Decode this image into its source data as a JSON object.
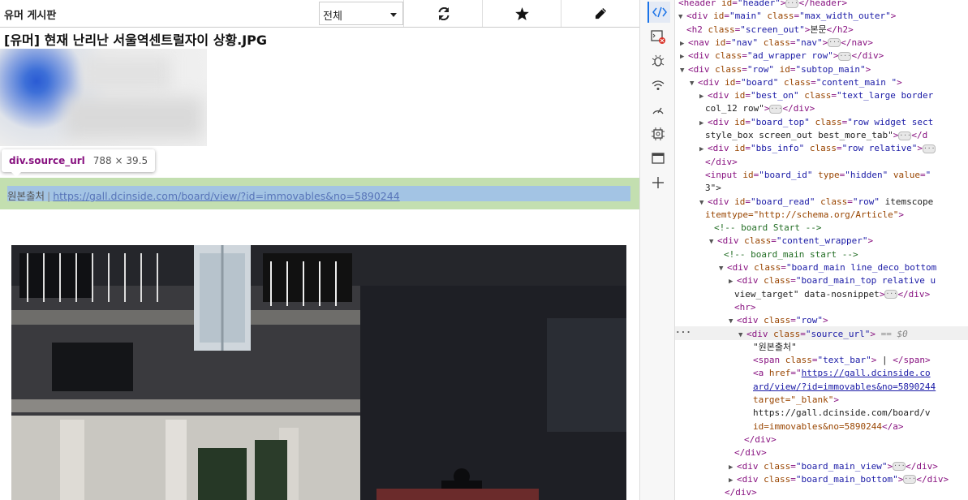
{
  "topbar": {
    "board_title": "유머 게시판",
    "select_value": "전체",
    "refresh_icon": "refresh-icon",
    "star_icon": "star-icon",
    "pencil_icon": "pencil-icon"
  },
  "post": {
    "title": "[유머] 현재 난리난 서울역센트럴자이 상황.JPG"
  },
  "tooltip": {
    "element": "div.source_url",
    "size": "788 × 39.5"
  },
  "source": {
    "label": "원본출처",
    "bar": "|",
    "url": "https://gall.dcinside.com/board/view/?id=immovables&no=5890244"
  },
  "devtools": {
    "dollar": "== $0",
    "more": "···",
    "lines": [
      "<header id=\"header\">⋯</header>",
      "<div id=\"main\" class=\"max_width_outer\">",
      "<h2 class=\"screen_out\">본문</h2>",
      "<nav id=\"nav\" class=\"nav\">⋯</nav>",
      "<div class=\"ad_wrapper row\">⋯</div>",
      "<div class=\"row\" id=\"subtop_main\">",
      "<div id=\"board\" class=\"content_main \">",
      "<div id=\"best_on\" class=\"text_large border",
      "col_12 row\">⋯</div>",
      "<div id=\"board_top\" class=\"row widget sect",
      "style_box screen_out best_more_tab\">⋯</d",
      "<div id=\"bbs_info\" class=\"row relative\">⋯",
      "</div>",
      "<input id=\"board_id\" type=\"hidden\" value=\"",
      "3\">",
      "<div id=\"board_read\" class=\"row\" itemscope",
      "itemtype=\"http://schema.org/Article\">",
      "<!-- board Start -->",
      "<div class=\"content_wrapper\">",
      "<!-- board_main start -->",
      "<div class=\"board_main line_deco_bottom",
      "<div class=\"board_main_top relative u",
      "view_target\" data-nosnippet>⋯</div>",
      "<hr>",
      "<div class=\"row\">",
      "<div class=\"source_url\">",
      "\"원본출처\"",
      "<span class=\"text_bar\"> | </span>",
      "<a href=\"https://gall.dcinside.co",
      "ard/view/?id=immovables&no=5890244",
      "target=\"_blank\">",
      "https://gall.dcinside.com/board/v",
      "id=immovables&no=5890244</a>",
      "</div>",
      "</div>",
      "<div class=\"board_main_view\">⋯</div>",
      "<div class=\"board_main_bottom\">⋯</div>",
      "</div>"
    ]
  }
}
